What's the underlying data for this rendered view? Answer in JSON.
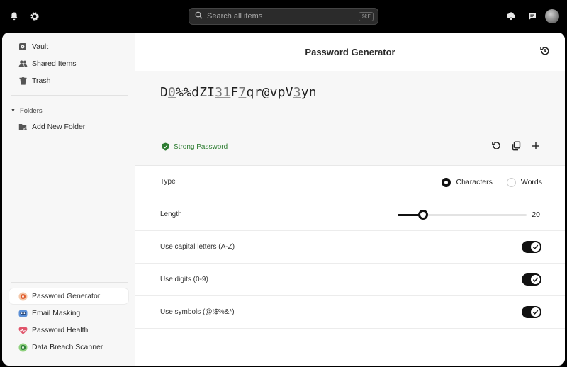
{
  "topbar": {
    "search_placeholder": "Search all items",
    "search_shortcut": "⌘F"
  },
  "sidebar": {
    "nav": [
      {
        "label": "Vault",
        "icon": "vault-icon"
      },
      {
        "label": "Shared Items",
        "icon": "people-icon"
      },
      {
        "label": "Trash",
        "icon": "trash-icon"
      }
    ],
    "folders_label": "Folders",
    "add_folder_label": "Add New Folder",
    "tools": [
      {
        "label": "Password Generator",
        "icon": "password-generator-icon",
        "active": true
      },
      {
        "label": "Email Masking",
        "icon": "email-masking-icon",
        "active": false
      },
      {
        "label": "Password Health",
        "icon": "password-health-icon",
        "active": false
      },
      {
        "label": "Data Breach Scanner",
        "icon": "data-breach-scanner-icon",
        "active": false
      }
    ]
  },
  "main": {
    "title": "Password Generator",
    "password_parts": [
      {
        "text": "D",
        "hl": false
      },
      {
        "text": "0",
        "hl": true
      },
      {
        "text": "%%dZI",
        "hl": false
      },
      {
        "text": "31",
        "hl": true
      },
      {
        "text": "F",
        "hl": false
      },
      {
        "text": "7",
        "hl": true
      },
      {
        "text": "qr@vpV",
        "hl": false
      },
      {
        "text": "3",
        "hl": true
      },
      {
        "text": "yn",
        "hl": false
      }
    ],
    "strength_label": "Strong Password",
    "type_label": "Type",
    "type_options": [
      {
        "label": "Characters",
        "selected": true
      },
      {
        "label": "Words",
        "selected": false
      }
    ],
    "length_label": "Length",
    "length_value": "20",
    "length_fraction": 0.2,
    "options": [
      {
        "label": "Use capital letters (A-Z)",
        "enabled": true
      },
      {
        "label": "Use digits (0-9)",
        "enabled": true
      },
      {
        "label": "Use symbols (@!$%&*)",
        "enabled": true
      }
    ]
  },
  "colors": {
    "strength": "#2e7d32",
    "accent": "#111111"
  }
}
